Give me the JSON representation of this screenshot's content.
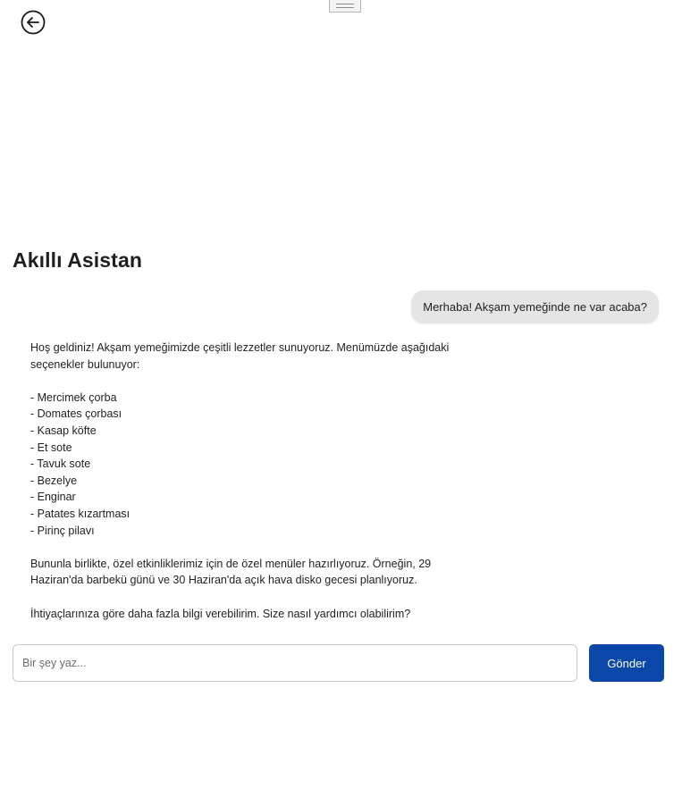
{
  "header": {
    "back_icon": "arrow-left-circle-icon",
    "drag_handle_icon": "drag-handle-icon"
  },
  "page_title": "Akıllı Asistan",
  "chat": {
    "user_message": "Merhaba! Akşam yemeğinde ne var acaba?",
    "assistant_message": {
      "intro_line_1": "Hoş geldiniz! Akşam yemeğimizde çeşitli lezzetler sunuyoruz. Menümüzde aşağıdaki",
      "intro_line_2": "seçenekler bulunuyor:",
      "menu_items": [
        "- Mercimek çorba",
        "- Domates çorbası",
        "- Kasap köfte",
        "- Et sote",
        "- Tavuk sote",
        "- Bezelye",
        "- Enginar",
        "- Patates kızartması",
        "- Pirinç pilavı"
      ],
      "events_line_1": "Bununla birlikte, özel etkinliklerimiz için de özel menüler hazırlıyoruz. Örneğin, 29",
      "events_line_2": "Haziran'da barbekü günü ve 30 Haziran'da açık hava disko gecesi planlıyoruz.",
      "closing": "İhtiyaçlarınıza göre daha fazla bilgi verebilirim. Size nasıl yardımcı olabilirim?"
    }
  },
  "composer": {
    "placeholder": "Bir şey yaz...",
    "value": "",
    "send_label": "Gönder"
  },
  "colors": {
    "accent": "#0a47a9",
    "user_bubble": "#e5e5e5",
    "background": "#ffffff"
  }
}
